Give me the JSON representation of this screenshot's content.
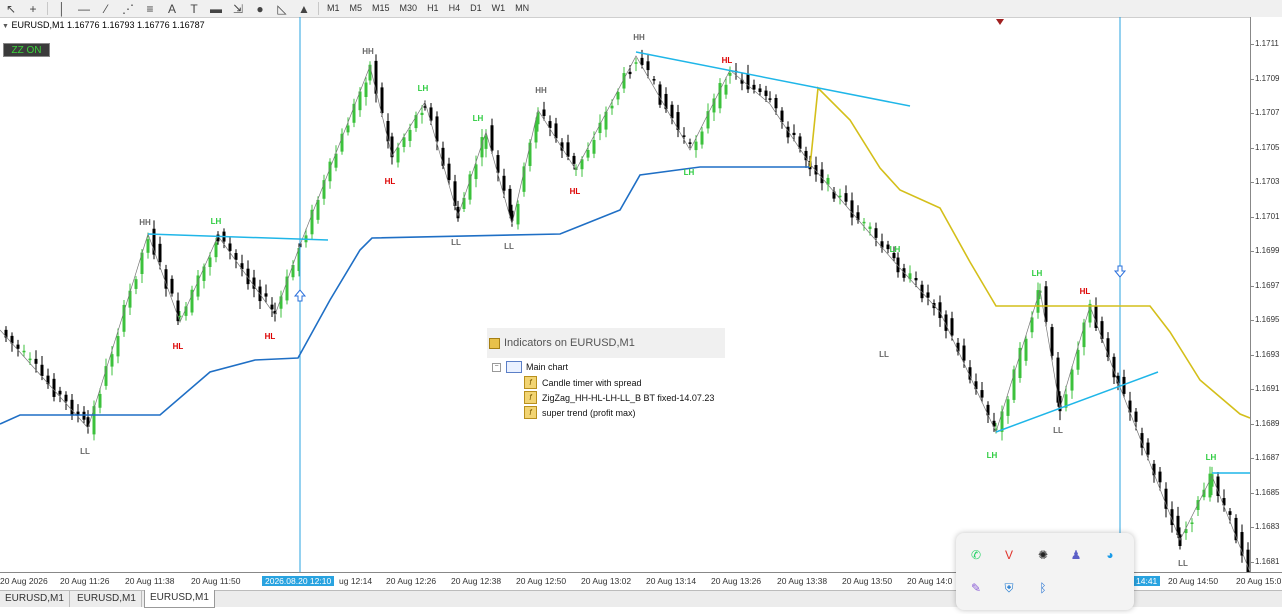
{
  "toolbar": {
    "timeframes": [
      "M1",
      "M5",
      "M15",
      "M30",
      "H1",
      "H4",
      "D1",
      "W1",
      "MN"
    ],
    "tools": [
      "cursor-icon",
      "crosshair-icon",
      "vertical-line-icon",
      "horizontal-line-icon",
      "trendline-icon",
      "fibonacci-icon",
      "channel-icon",
      "text-icon",
      "text-label-icon",
      "rectangle-icon",
      "arrow-dropdown-icon",
      "ellipse-icon",
      "triangle-icon",
      "up-arrow-icon"
    ]
  },
  "chart": {
    "symbol": "EURUSD,M1",
    "ohlc": "1.16776 1.16793 1.16776 1.16787",
    "zz_button": "ZZ ON",
    "price_labels": [
      "1.1711",
      "1.1709",
      "1.1707",
      "1.1705",
      "1.1703",
      "1.1701",
      "1.1699",
      "1.1697",
      "1.1695",
      "1.1693",
      "1.1691",
      "1.1689",
      "1.1687",
      "1.1685",
      "1.1683",
      "1.1681"
    ],
    "time_labels": [
      "20 Aug 2026",
      "20 Aug 11:26",
      "20 Aug 11:38",
      "20 Aug 11:50",
      "2026.08.20 12:10",
      "ug 12:14",
      "20 Aug 12:26",
      "20 Aug 12:38",
      "20 Aug 12:50",
      "20 Aug 13:02",
      "20 Aug 13:14",
      "20 Aug 13:26",
      "20 Aug 13:38",
      "20 Aug 13:50",
      "20 Aug 14:0",
      "14:41",
      "20 Aug 14:50",
      "20 Aug 15:0"
    ],
    "zigzag_labels": [
      {
        "text": "HH",
        "color": "#666666"
      },
      {
        "text": "LH",
        "color": "#2ecc40"
      },
      {
        "text": "HL",
        "color": "#dd0000"
      },
      {
        "text": "HL",
        "color": "#dd0000"
      },
      {
        "text": "LL",
        "color": "#666666"
      },
      {
        "text": "HH",
        "color": "#666666"
      },
      {
        "text": "LH",
        "color": "#2ecc40"
      },
      {
        "text": "HL",
        "color": "#dd0000"
      },
      {
        "text": "LH",
        "color": "#2ecc40"
      },
      {
        "text": "LL",
        "color": "#666666"
      },
      {
        "text": "LL",
        "color": "#666666"
      },
      {
        "text": "HH",
        "color": "#666666"
      },
      {
        "text": "HL",
        "color": "#dd0000"
      },
      {
        "text": "HH",
        "color": "#666666"
      },
      {
        "text": "LH",
        "color": "#2ecc40"
      },
      {
        "text": "HL",
        "color": "#dd0000"
      },
      {
        "text": "LH",
        "color": "#2ecc40"
      },
      {
        "text": "LL",
        "color": "#666666"
      },
      {
        "text": "LH",
        "color": "#2ecc40"
      },
      {
        "text": "LH",
        "color": "#2ecc40"
      },
      {
        "text": "HL",
        "color": "#dd0000"
      },
      {
        "text": "LL",
        "color": "#666666"
      },
      {
        "text": "LH",
        "color": "#2ecc40"
      },
      {
        "text": "LL",
        "color": "#666666"
      },
      {
        "text": "LL",
        "color": "#666666"
      }
    ],
    "colors": {
      "bull": "#3cc13c",
      "bear": "#000000",
      "supertrend": "#1f6fc5",
      "trend_up": "#d4bf1a",
      "trendline": "#1fb6e8",
      "vline": "#29a3e0"
    }
  },
  "indicators_panel": {
    "title": "Indicators on EURUSD,M1",
    "root": "Main chart",
    "items": [
      "Candle timer with spread",
      "ZigZag_HH-HL-LH-LL_B BT fixed-14.07.23",
      "super trend (profit max)"
    ]
  },
  "tabs": [
    "EURUSD,M1",
    "EURUSD,M1",
    "EURUSD,M1"
  ],
  "active_tab": 2,
  "tray_icons": [
    "whatsapp-icon",
    "vivaldi-icon",
    "chatgpt-icon",
    "teams-icon",
    "copilot-icon",
    "pen-icon",
    "defender-icon",
    "bluetooth-icon"
  ]
}
